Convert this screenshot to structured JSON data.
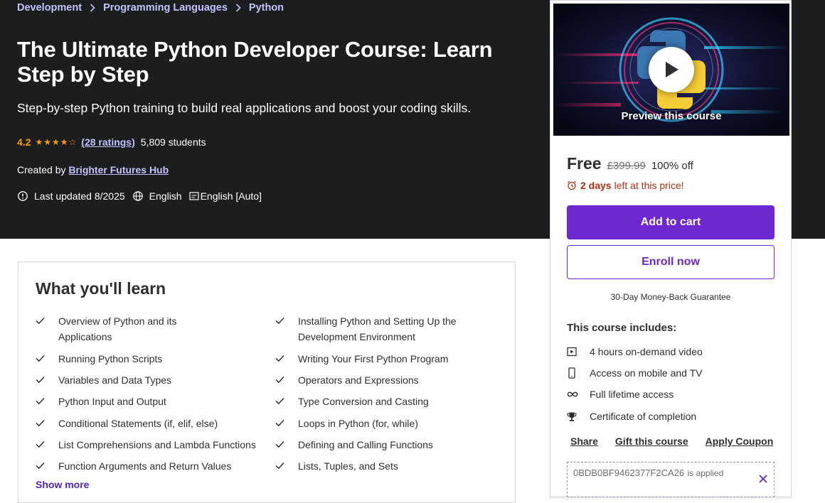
{
  "breadcrumb": [
    "Development",
    "Programming Languages",
    "Python"
  ],
  "course": {
    "title": "The Ultimate Python Developer Course: Learn Step by Step",
    "subtitle": "Step-by-step Python training to build real applications and boost your coding skills.",
    "rating": "4.2",
    "stars_value": 4.2,
    "stars_max": 5,
    "ratings_link": "(28 ratings)",
    "students": "5,809 students",
    "created_by_label": "Created by",
    "instructor": "Brighter Futures Hub",
    "last_updated": "Last updated 8/2025",
    "language": "English",
    "captions": "English [Auto]"
  },
  "learn": {
    "title": "What you'll learn",
    "items": [
      "Overview of Python and its Applications",
      "Installing Python and Setting Up the Development Environment",
      "Running Python Scripts",
      "Writing Your First Python Program",
      "Variables and Data Types",
      "Operators and Expressions",
      "Python Input and Output",
      "Type Conversion and Casting",
      "Conditional Statements (if, elif, else)",
      "Loops in Python (for, while)",
      "List Comprehensions and Lambda Functions",
      "Defining and Calling Functions",
      "Function Arguments and Return Values",
      "Lists, Tuples, and Sets"
    ],
    "show_more": "Show more"
  },
  "card": {
    "preview_label": "Preview this course",
    "price": "Free",
    "original_price": "£399.99",
    "discount": "100% off",
    "timer_days": "2 days",
    "timer_rest": "left at this price!",
    "add_to_cart": "Add to cart",
    "enroll_now": "Enroll now",
    "guarantee": "30-Day Money-Back Guarantee",
    "includes_title": "This course includes:",
    "includes": [
      {
        "icon": "video-icon",
        "label": "4 hours on-demand video"
      },
      {
        "icon": "mobile-icon",
        "label": "Access on mobile and TV"
      },
      {
        "icon": "infinity-icon",
        "label": "Full lifetime access"
      },
      {
        "icon": "trophy-icon",
        "label": "Certificate of completion"
      }
    ],
    "actions": [
      "Share",
      "Gift this course",
      "Apply Coupon"
    ],
    "coupon_code": "0BDB0BF9462377F2CA26",
    "coupon_note": "is applied"
  },
  "colors": {
    "hero_bg": "#1c1d1f",
    "accent": "#6d28d2",
    "link_light": "#c0c4fc",
    "star": "#f69c08",
    "timer": "#b32d0f"
  }
}
